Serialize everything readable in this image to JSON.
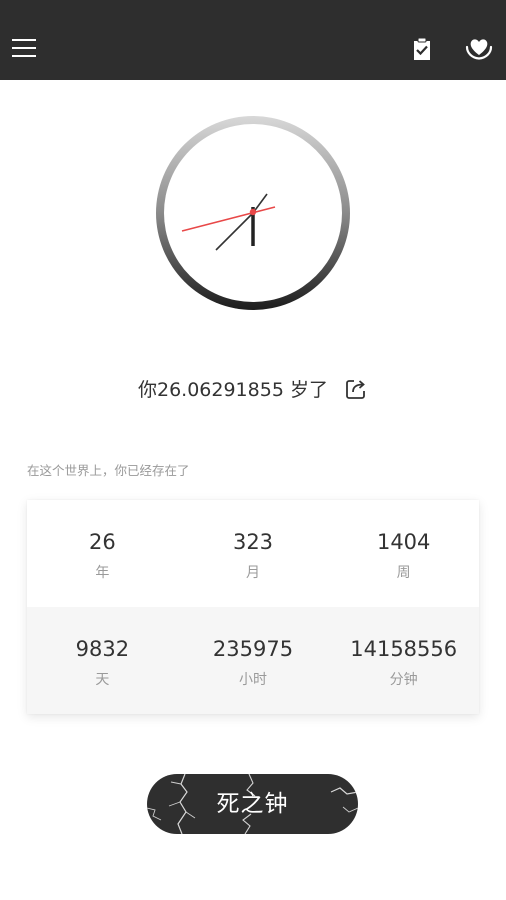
{
  "toolbar": {
    "menu_icon": "menu-icon",
    "task_icon": "clipboard-check-icon",
    "heart_icon": "heart-hands-icon",
    "background_color": "#2e2e2e"
  },
  "clock": {
    "second_hand_color": "#e84848",
    "hand_color": "#333333"
  },
  "age": {
    "text": "你26.06291855 岁了",
    "share_icon": "share-icon"
  },
  "stats": {
    "caption": "在这个世界上，你已经存在了",
    "items": [
      {
        "value": "26",
        "unit": "年"
      },
      {
        "value": "323",
        "unit": "月"
      },
      {
        "value": "1404",
        "unit": "周"
      },
      {
        "value": "9832",
        "unit": "天"
      },
      {
        "value": "235975",
        "unit": "小时"
      },
      {
        "value": "14158556",
        "unit": "分钟"
      }
    ]
  },
  "death_button": {
    "label": "死之钟",
    "color": "#2f2f2f"
  }
}
